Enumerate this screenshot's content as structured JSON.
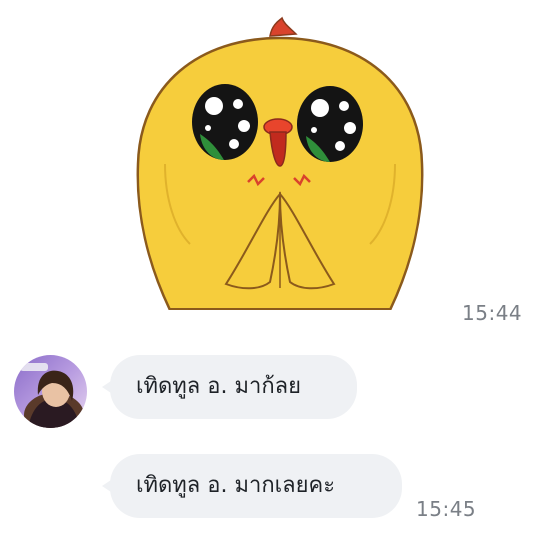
{
  "messages": [
    {
      "type": "sticker",
      "sticker_name": "yellow-chick-pleading-sticker",
      "time": "15:44"
    },
    {
      "type": "text",
      "text": "เทิดทูล อ. มาก้ลย"
    },
    {
      "type": "text",
      "text": "เทิดทูล อ. มากเลยคะ",
      "time": "15:45"
    }
  ],
  "colors": {
    "bubble_bg": "#eff1f4",
    "time_text": "#7a7f86",
    "message_text": "#1f2328",
    "sticker_yellow": "#f6cd3c"
  }
}
